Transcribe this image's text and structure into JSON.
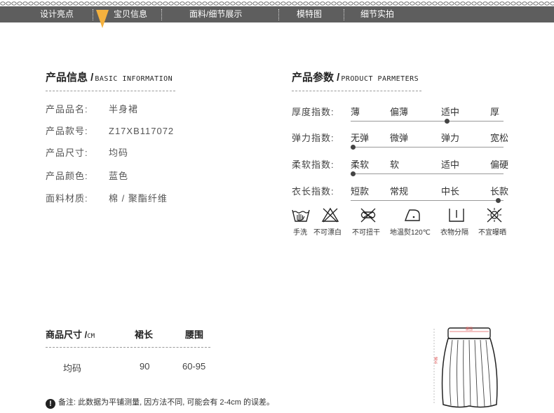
{
  "nav": {
    "items": [
      "设计亮点",
      "宝贝信息",
      "面料/细节展示",
      "模特图",
      "细节实拍"
    ],
    "colors": {
      "bar": "#5e5e5e",
      "pointer": "#f4b13e"
    }
  },
  "info": {
    "title_cn": "产品信息 /",
    "title_en": "BASIC INFORMATION",
    "rows": [
      {
        "label": "产品品名:",
        "value": "半身裙"
      },
      {
        "label": "产品款号:",
        "value": "Z17XB117072"
      },
      {
        "label": "产品尺寸:",
        "value": "均码"
      },
      {
        "label": "产品颜色:",
        "value": "蓝色"
      },
      {
        "label": "面料材质:",
        "value": "棉 / 聚酯纤维"
      }
    ]
  },
  "params": {
    "title_cn": "产品参数 /",
    "title_en": "PRODUCT PARMETERS",
    "rows": [
      {
        "label": "厚度指数:",
        "options": [
          "薄",
          "偏薄",
          "适中",
          "厚"
        ],
        "selected_index": 2
      },
      {
        "label": "弹力指数:",
        "options": [
          "无弹",
          "微弹",
          "弹力",
          "宽松"
        ],
        "selected_index": 0
      },
      {
        "label": "柔软指数:",
        "options": [
          "柔软",
          "软",
          "适中",
          "偏硬"
        ],
        "selected_index": 0
      },
      {
        "label": "衣长指数:",
        "options": [
          "短款",
          "常规",
          "中长",
          "长款"
        ],
        "selected_index": 3
      }
    ]
  },
  "care": {
    "items": [
      {
        "icon": "hand-wash-icon",
        "label": "手洗"
      },
      {
        "icon": "no-bleach-icon",
        "label": "不可漂白"
      },
      {
        "icon": "no-wring-icon",
        "label": "不可扭干"
      },
      {
        "icon": "iron-low-temp-icon",
        "label": "地温熨120℃"
      },
      {
        "icon": "hang-dry-icon",
        "label": "衣物分隔"
      },
      {
        "icon": "no-sun-dry-icon",
        "label": "不宜曝晒"
      }
    ]
  },
  "size_table": {
    "headers": [
      "商品尺寸 /",
      "裙长",
      "腰围"
    ],
    "unit": "CM",
    "rows": [
      [
        "均码",
        "90",
        "60-95"
      ]
    ]
  },
  "note": {
    "icon": "exclamation-icon",
    "text": "备注: 此数据为平铺测量, 因方法不同, 可能会有 2-4cm 的误差。"
  },
  "diagram": {
    "waist_label": "腰围",
    "length_label": "裙长",
    "accent": "#e05a5a"
  }
}
